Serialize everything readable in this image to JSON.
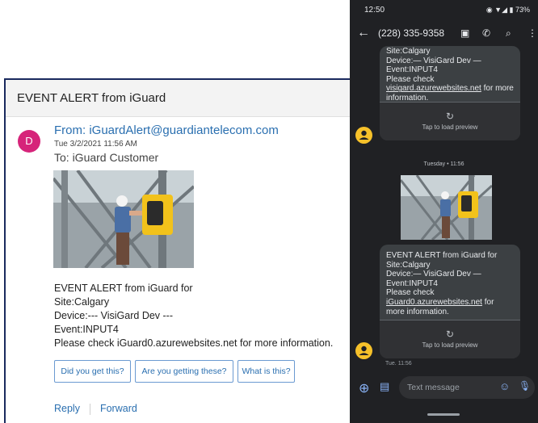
{
  "email": {
    "subject": "EVENT ALERT from iGuard",
    "avatar_letter": "D",
    "from": "From: iGuardAlert@guardiantelecom.com",
    "date": "Tue 3/2/2021 11:56 AM",
    "to": "To: iGuard Customer",
    "body": [
      "EVENT ALERT from iGuard for",
      "Site:Calgary",
      "Device:--- VisiGard Dev ---",
      "Event:INPUT4",
      "Please check iGuard0.azurewebsites.net for more information."
    ],
    "quick_replies": [
      "Did you get this?",
      "Are you getting these?",
      "What is this?"
    ],
    "reply_label": "Reply",
    "forward_label": "Forward"
  },
  "phone": {
    "status_time": "12:50",
    "battery": "73%",
    "contact_number": "(228) 335-9358",
    "message1": {
      "lines": [
        "Site:Calgary",
        "Device:— VisiGard Dev —",
        "Event:INPUT4",
        "Please check"
      ],
      "link": "visigard.azurewebsites.net",
      "after_link": " for more information."
    },
    "preview_label": "Tap to load preview",
    "day_label": "Tuesday • 11:56",
    "message2": {
      "lines": [
        "EVENT ALERT from iGuard for",
        "Site:Calgary",
        "Device:— VisiGard Dev —",
        "Event:INPUT4",
        "Please check"
      ],
      "link": "iGuard0.azurewebsites.net",
      "after_link": " for more information."
    },
    "timestamp": "Tue. 11:56",
    "compose_placeholder": "Text message",
    "colors": {
      "contact_avatar": "#f6c12a",
      "accent": "#8ab4f8",
      "bubble": "#3c4043"
    }
  }
}
